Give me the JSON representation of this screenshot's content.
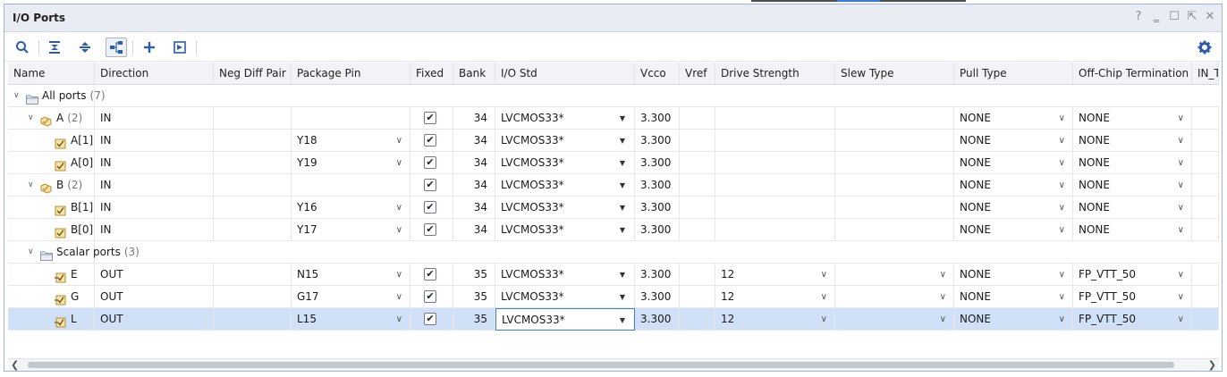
{
  "window": {
    "title": "I/O Ports"
  },
  "title_controls": {
    "help": "?",
    "minimize": "‗",
    "maximize": "☐",
    "float": "⇱",
    "close": "✕"
  },
  "toolbar": {
    "icons": [
      "search-icon",
      "collapse-all-icon",
      "expand-all-icon",
      "group-by-interface-icon",
      "add-icon",
      "auto-assign-icon",
      "settings-icon"
    ]
  },
  "columns": [
    "Name",
    "Direction",
    "Neg Diff Pair",
    "Package Pin",
    "Fixed",
    "Bank",
    "I/O Std",
    "Vcco",
    "Vref",
    "Drive Strength",
    "Slew Type",
    "Pull Type",
    "Off-Chip Termination",
    "IN_T"
  ],
  "rows": [
    {
      "name": "All ports",
      "count": "(7)",
      "direction": "",
      "pin": "",
      "fixed": "",
      "bank": "",
      "iostd": "",
      "vcco": "",
      "drive": "",
      "slew": "",
      "pull": "",
      "term": ""
    },
    {
      "name": "A",
      "count": "(2)",
      "direction": "IN",
      "pin": "",
      "fixed": "✔",
      "bank": "34",
      "iostd": "LVCMOS33*",
      "vcco": "3.300",
      "drive": "",
      "slew": "",
      "pull": "NONE",
      "term": "NONE"
    },
    {
      "name": "A[1]",
      "count": "",
      "direction": "IN",
      "pin": "Y18",
      "fixed": "✔",
      "bank": "34",
      "iostd": "LVCMOS33*",
      "vcco": "3.300",
      "drive": "",
      "slew": "",
      "pull": "NONE",
      "term": "NONE"
    },
    {
      "name": "A[0]",
      "count": "",
      "direction": "IN",
      "pin": "Y19",
      "fixed": "✔",
      "bank": "34",
      "iostd": "LVCMOS33*",
      "vcco": "3.300",
      "drive": "",
      "slew": "",
      "pull": "NONE",
      "term": "NONE"
    },
    {
      "name": "B",
      "count": "(2)",
      "direction": "IN",
      "pin": "",
      "fixed": "✔",
      "bank": "34",
      "iostd": "LVCMOS33*",
      "vcco": "3.300",
      "drive": "",
      "slew": "",
      "pull": "NONE",
      "term": "NONE"
    },
    {
      "name": "B[1]",
      "count": "",
      "direction": "IN",
      "pin": "Y16",
      "fixed": "✔",
      "bank": "34",
      "iostd": "LVCMOS33*",
      "vcco": "3.300",
      "drive": "",
      "slew": "",
      "pull": "NONE",
      "term": "NONE"
    },
    {
      "name": "B[0]",
      "count": "",
      "direction": "IN",
      "pin": "Y17",
      "fixed": "✔",
      "bank": "34",
      "iostd": "LVCMOS33*",
      "vcco": "3.300",
      "drive": "",
      "slew": "",
      "pull": "NONE",
      "term": "NONE"
    },
    {
      "name": "Scalar ports",
      "count": "(3)",
      "direction": "",
      "pin": "",
      "fixed": "",
      "bank": "",
      "iostd": "",
      "vcco": "",
      "drive": "",
      "slew": "",
      "pull": "",
      "term": ""
    },
    {
      "name": "E",
      "count": "",
      "direction": "OUT",
      "pin": "N15",
      "fixed": "✔",
      "bank": "35",
      "iostd": "LVCMOS33*",
      "vcco": "3.300",
      "drive": "12",
      "slew": "",
      "pull": "NONE",
      "term": "FP_VTT_50"
    },
    {
      "name": "G",
      "count": "",
      "direction": "OUT",
      "pin": "G17",
      "fixed": "✔",
      "bank": "35",
      "iostd": "LVCMOS33*",
      "vcco": "3.300",
      "drive": "12",
      "slew": "",
      "pull": "NONE",
      "term": "FP_VTT_50"
    },
    {
      "name": "L",
      "count": "",
      "direction": "OUT",
      "pin": "L15",
      "fixed": "✔",
      "bank": "35",
      "iostd": "LVCMOS33*",
      "vcco": "3.300",
      "drive": "12",
      "slew": "",
      "pull": "NONE",
      "term": "FP_VTT_50"
    }
  ],
  "colors": {
    "accent": "#3a7bd5",
    "selected_row": "#cfe0f7",
    "header_bg": "#f1f3f6",
    "folder": "#c9a23a"
  }
}
